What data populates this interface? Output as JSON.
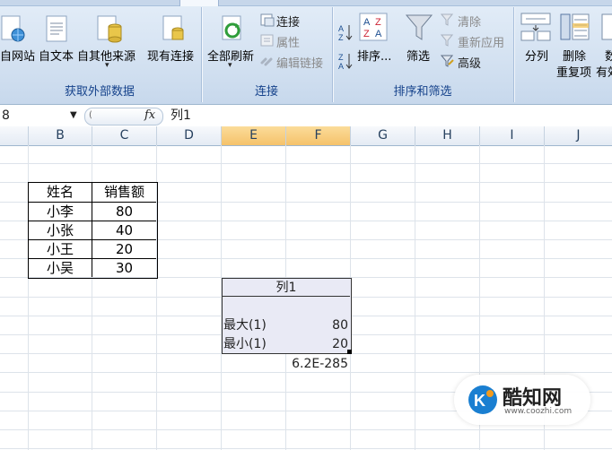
{
  "ribbon": {
    "groups": {
      "external": {
        "label": "获取外部数据",
        "buttons": [
          "自网站",
          "自文本",
          "自其他来源",
          "现有连接"
        ]
      },
      "connections": {
        "label": "连接",
        "refresh_all": "全部刷新",
        "connect": "连接",
        "properties": "属性",
        "edit_links": "编辑链接"
      },
      "sort_filter": {
        "label": "排序和筛选",
        "sort": "排序...",
        "filter": "筛选",
        "clear": "清除",
        "reapply": "重新应用",
        "advanced": "高级"
      },
      "data_tools": {
        "split": "分列",
        "remove_dup_line1": "删除",
        "remove_dup_line2": "重复项",
        "validation_line1": "数",
        "validation_line2": "有效"
      }
    }
  },
  "formula_bar": {
    "name_box": "8",
    "fx": "fx",
    "formula": "列1"
  },
  "columns": [
    "B",
    "C",
    "D",
    "E",
    "F",
    "G",
    "H",
    "I",
    "J"
  ],
  "table": {
    "headers": [
      "姓名",
      "销售额"
    ],
    "rows": [
      [
        "小李",
        "80"
      ],
      [
        "小张",
        "40"
      ],
      [
        "小王",
        "20"
      ],
      [
        "小吴",
        "30"
      ]
    ]
  },
  "output": {
    "header": "列1",
    "max_label": "最大(1)",
    "max_value": "80",
    "min_label": "最小(1)",
    "min_value": "20",
    "extra_value": "6.2E-285"
  },
  "watermark": {
    "brand": "酷知网",
    "url": "www.coozhi.com"
  }
}
